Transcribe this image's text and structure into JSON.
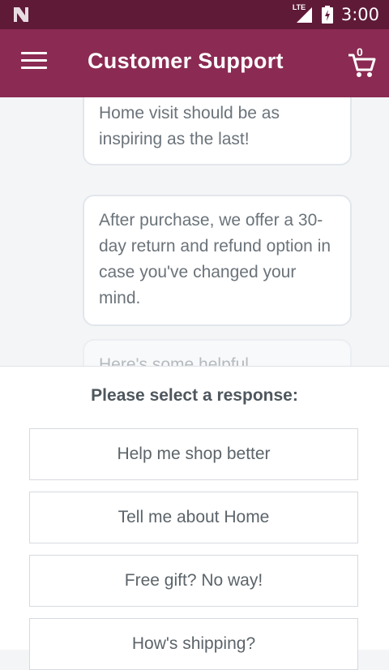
{
  "status_bar": {
    "network_label": "LTE",
    "time": "3:00",
    "icons": [
      "notification-n-icon",
      "signal-icon",
      "battery-charging-icon"
    ]
  },
  "app_bar": {
    "title": "Customer Support",
    "cart_count": "0",
    "icons": [
      "menu-icon",
      "shopping-cart-icon"
    ]
  },
  "messages": [
    {
      "text": "you never knew existed. Each Home visit should be as inspiring as the last!"
    },
    {
      "text": "After purchase, we offer a 30-day return and refund option in case you've changed your mind."
    },
    {
      "text": "Here's some helpful"
    }
  ],
  "response_panel": {
    "prompt": "Please select a response:",
    "options": [
      "Help me shop better",
      "Tell me about Home",
      "Free gift? No way!",
      "How's shipping?"
    ]
  },
  "colors": {
    "status_bar": "#5f1a38",
    "app_bar": "#8b2a52",
    "background": "#f4f5f7"
  }
}
